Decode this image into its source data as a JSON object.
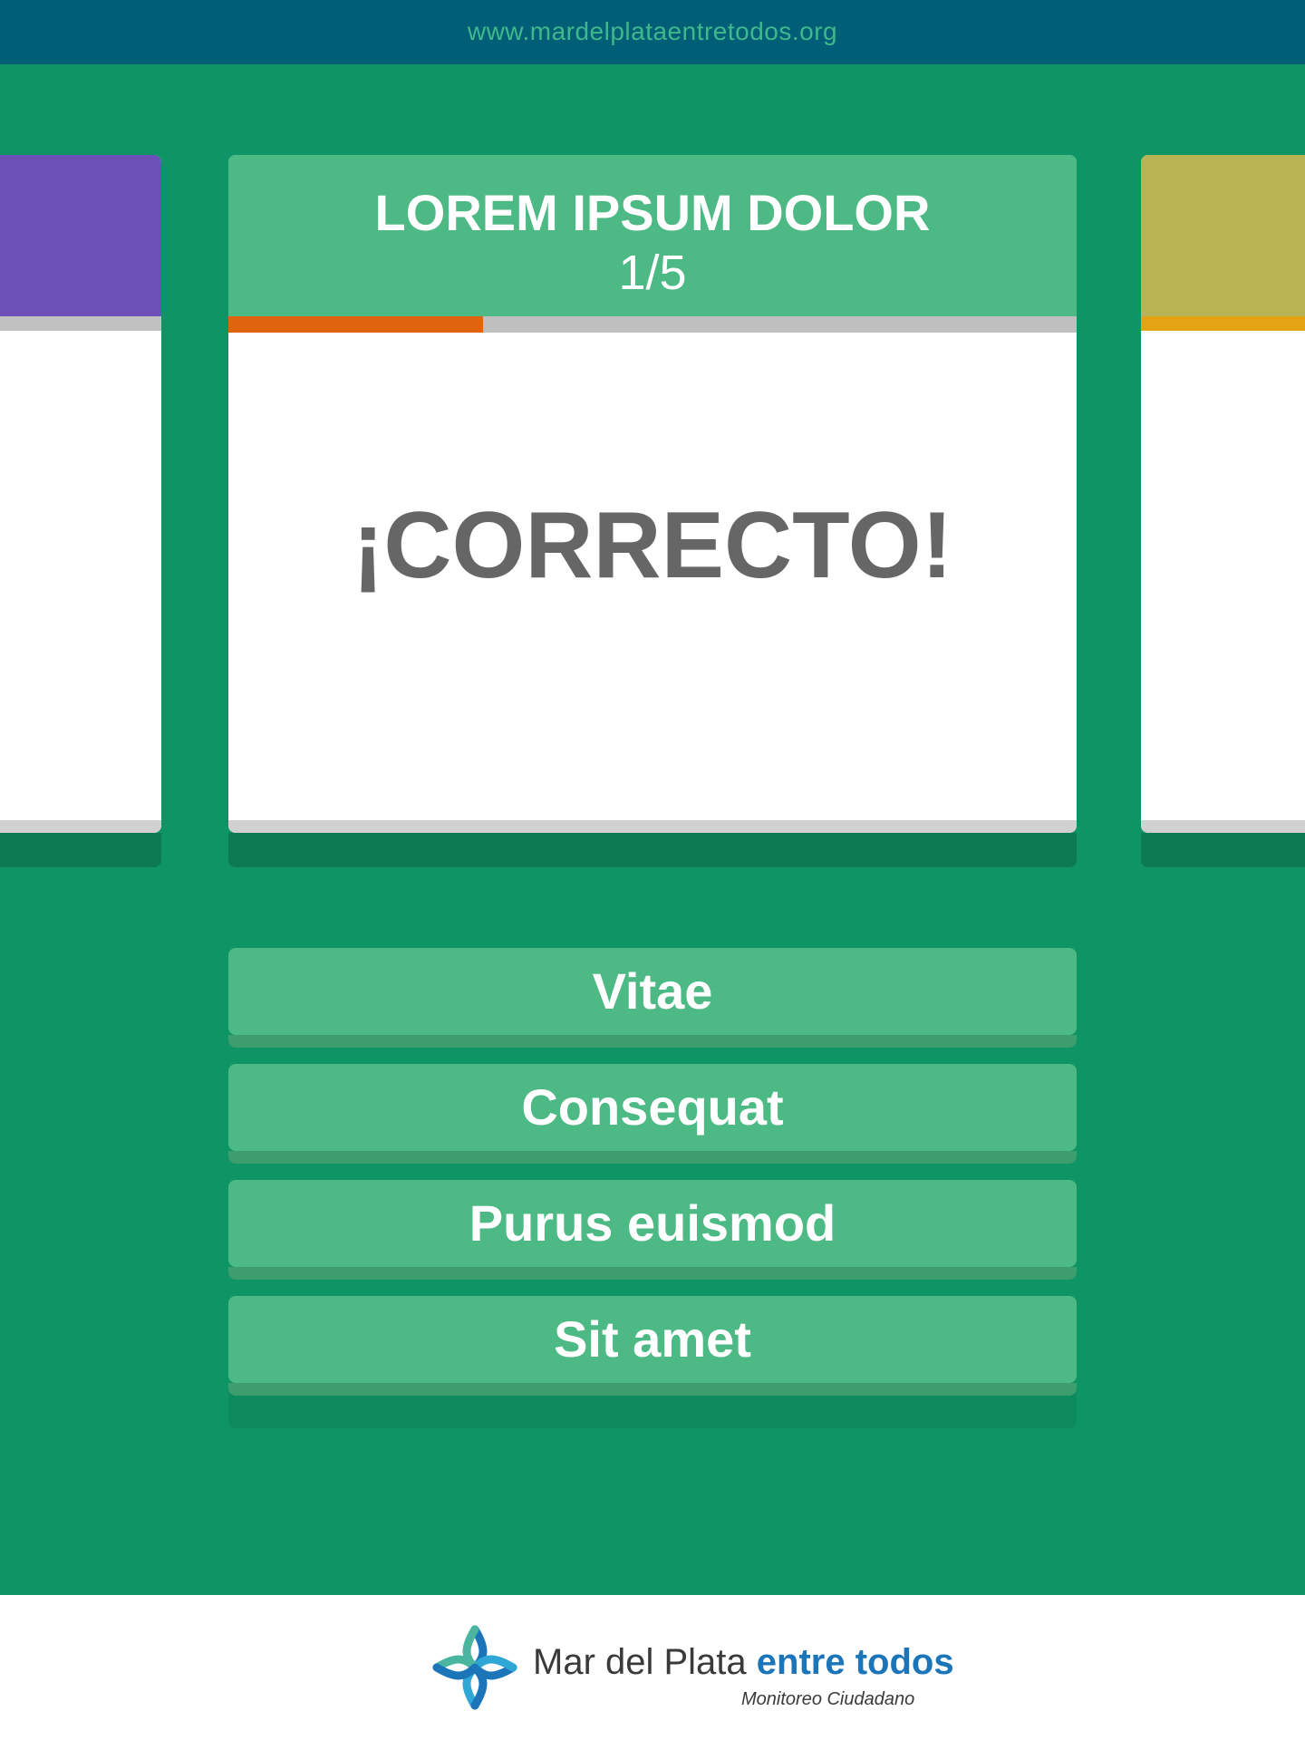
{
  "header": {
    "url": "www.mardelplataentretodos.org"
  },
  "quiz": {
    "title": "LOREM IPSUM DOLOR",
    "counter": "1/5",
    "progress": 0.3,
    "result": "¡CORRECTO!"
  },
  "side_cards": {
    "left_color": "#6d4fb8",
    "right_color": "#b8b454",
    "right_accent": "#e2a412"
  },
  "answers": [
    {
      "label": "Vitae"
    },
    {
      "label": "Consequat"
    },
    {
      "label": "Purus euismod"
    },
    {
      "label": "Sit amet"
    }
  ],
  "footer": {
    "brand_name": "Mar del Plata",
    "brand_accent": "entre todos",
    "tagline": "Monitoreo Ciudadano",
    "logo_icon": "star-knot-logo-icon"
  },
  "colors": {
    "background": "#0e9465",
    "topbar": "#005e76",
    "card_header": "#4db985",
    "progress": "#e0630f",
    "result_text": "#666666"
  }
}
